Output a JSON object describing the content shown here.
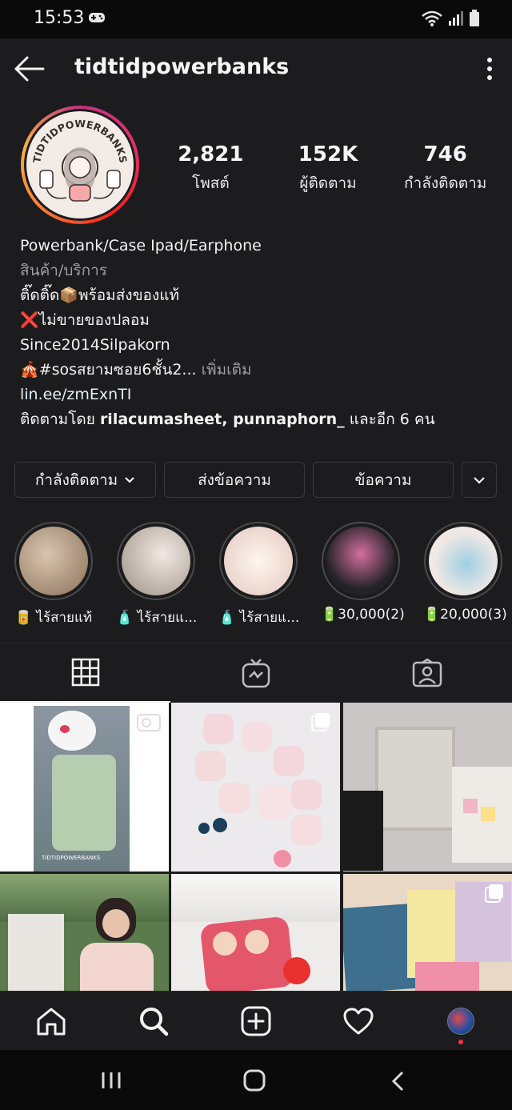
{
  "status": {
    "time": "15:53"
  },
  "header": {
    "username": "tidtidpowerbanks"
  },
  "avatar": {
    "logo_text": "TIDTIDPOWERBANKS"
  },
  "stats": [
    {
      "value": "2,821",
      "label": "โพสต์"
    },
    {
      "value": "152K",
      "label": "ผู้ติดตาม"
    },
    {
      "value": "746",
      "label": "กำลังติดตาม"
    }
  ],
  "bio": {
    "name": "Powerbank/Case Ipad/Earphone",
    "category": "สินค้า/บริการ",
    "line1_a": "ติ๊ดติ๊ด",
    "line1_emoji": "📦",
    "line1_b": "พร้อมส่งของแท้",
    "line2_emoji": "❌",
    "line2": "ไม่ขายของปลอม",
    "line3": "Since2014Silpakorn",
    "line4_emoji": "🎪",
    "line4": "#sosสยามซอย6ชั้น2...",
    "line4_more": " เพิ่มเติม",
    "link": "lin.ee/zmExnTI",
    "followed_prefix": "ติดตามโดย ",
    "followed_names": "rilacumasheet, punnaphorn_",
    "followed_suffix": " และอีก 6 คน"
  },
  "actions": {
    "follow": "กำลังติดตาม",
    "message": "ส่งข้อความ",
    "contact": "ข้อความ"
  },
  "highlights": [
    {
      "label": "🥫 ไร้สายแท้",
      "color": "#b9a48d"
    },
    {
      "label": "🧴 ไร้สายแ...",
      "color": "#cbbfb4"
    },
    {
      "label": "🧴 ไร้สายแ...",
      "color": "#ece3d8"
    },
    {
      "label": "🔋30,000(2)",
      "color": "#2d2d35"
    },
    {
      "label": "🔋20,000(3)",
      "color": "#e6e0dc"
    }
  ],
  "tabs": [
    "grid-icon",
    "igtv-icon",
    "tagged-icon"
  ],
  "grid_watermark": "TIDTIDPOWERBANKS",
  "nav": [
    "home-icon",
    "search-icon",
    "add-icon",
    "heart-icon",
    "profile-icon"
  ]
}
